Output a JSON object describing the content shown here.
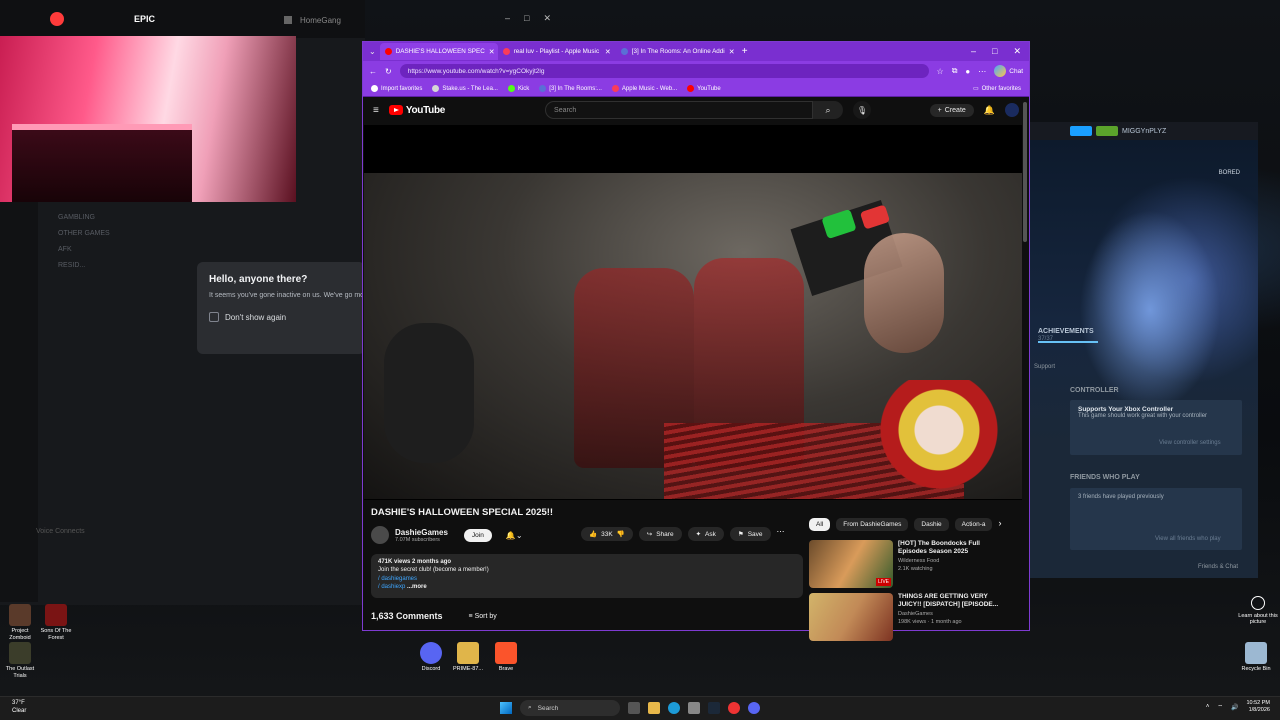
{
  "discord": {
    "brand_label": "EPIC",
    "obs_title": "HomeGang",
    "channels": [
      "GAMBLING",
      "OTHER GAMES",
      "AFK",
      "RESID..."
    ],
    "voice_connects": "Voice Connects",
    "popup": {
      "title": "Hello, anyone there?",
      "message": "It seems you've gone inactive on us. We've go moved you to the inactive channel.",
      "checkbox_label": "Don't show again"
    }
  },
  "steam": {
    "username": "MIGGYnPLYZ",
    "bored": "BORED",
    "achievements": "ACHIEVEMENTS",
    "achievements_count": "37/37",
    "achievements_progress": 1.0,
    "support": "Support",
    "controller_title": "CONTROLLER",
    "controller_card_title": "Supports Your Xbox Controller",
    "controller_card_text": "This game should work great with your controller",
    "controller_link": "View controller settings",
    "friends_title": "FRIENDS WHO PLAY",
    "friends_text": "3 friends have played previously",
    "friends_link": "View all friends who play",
    "friends_chat": "Friends & Chat"
  },
  "browser": {
    "tabs": [
      {
        "label": "DASHIE'S HALLOWEEN SPEC",
        "active": true,
        "color": "#ff0000"
      },
      {
        "label": "real luv - Playlist - Apple Music",
        "active": false,
        "color": "#fa3c5a"
      },
      {
        "label": "[3] In The Rooms: An Online Addi",
        "active": false,
        "color": "#5b6fd6"
      }
    ],
    "url": "https://www.youtube.com/watch?v=ygCOkyjt2lg",
    "chat_label": "Chat",
    "bookmarks": [
      {
        "label": "Import favorites",
        "color": "#ffffff"
      },
      {
        "label": "Stake.us - The Lea...",
        "color": "#d6d6d6"
      },
      {
        "label": "Kick",
        "color": "#53fc18"
      },
      {
        "label": "[3] In The Rooms:...",
        "color": "#5b6fd6"
      },
      {
        "label": "Apple Music - Web...",
        "color": "#fa3c5a"
      },
      {
        "label": "YouTube",
        "color": "#ff0000"
      }
    ],
    "other_favorites": "Other favorites"
  },
  "youtube": {
    "logo_text": "YouTube",
    "search_placeholder": "Search",
    "create_label": "Create",
    "video_title": "DASHIE'S HALLOWEEN SPECIAL 2025!!",
    "channel_name": "DashieGames",
    "subscribers": "7.07M subscribers",
    "join_label": "Join",
    "likes": "33K",
    "share_label": "Share",
    "ask_label": "Ask",
    "save_label": "Save",
    "views_line": "471K views  2 months ago",
    "desc_line1": "Join the secret club! (become a member!)",
    "desc_line2": "/ dashiegames",
    "desc_line3": "/ dashiexp",
    "more_label": "...more",
    "comments_count": "1,633 Comments",
    "sort_by": "Sort by",
    "chips": [
      "All",
      "From DashieGames",
      "Dashie",
      "Action-a"
    ],
    "recommendations": [
      {
        "title": "[HOT] The Boondocks Full Episodes Season 2025",
        "channel": "Wilderness Food",
        "meta": "2.1K watching",
        "live": "LIVE"
      },
      {
        "title": "THINGS ARE GETTING VERY JUICY!! [DISPATCH] [EPISODE...",
        "channel": "DashieGames",
        "meta": "198K views · 1 month ago",
        "live": ""
      }
    ]
  },
  "desktop": {
    "icons": [
      {
        "label": "Project Zomboid"
      },
      {
        "label": "Sons Of The Forest"
      },
      {
        "label": "The Outlast Trials"
      },
      {
        "label": "Discord"
      },
      {
        "label": "PRIME-87..."
      },
      {
        "label": "Brave"
      },
      {
        "label": "Recycle Bin"
      }
    ],
    "learn_more": "Learn about this picture"
  },
  "taskbar": {
    "temperature": "37°F",
    "condition": "Clear",
    "search_placeholder": "Search",
    "time": "10:52 PM",
    "date": "1/8/2026"
  }
}
